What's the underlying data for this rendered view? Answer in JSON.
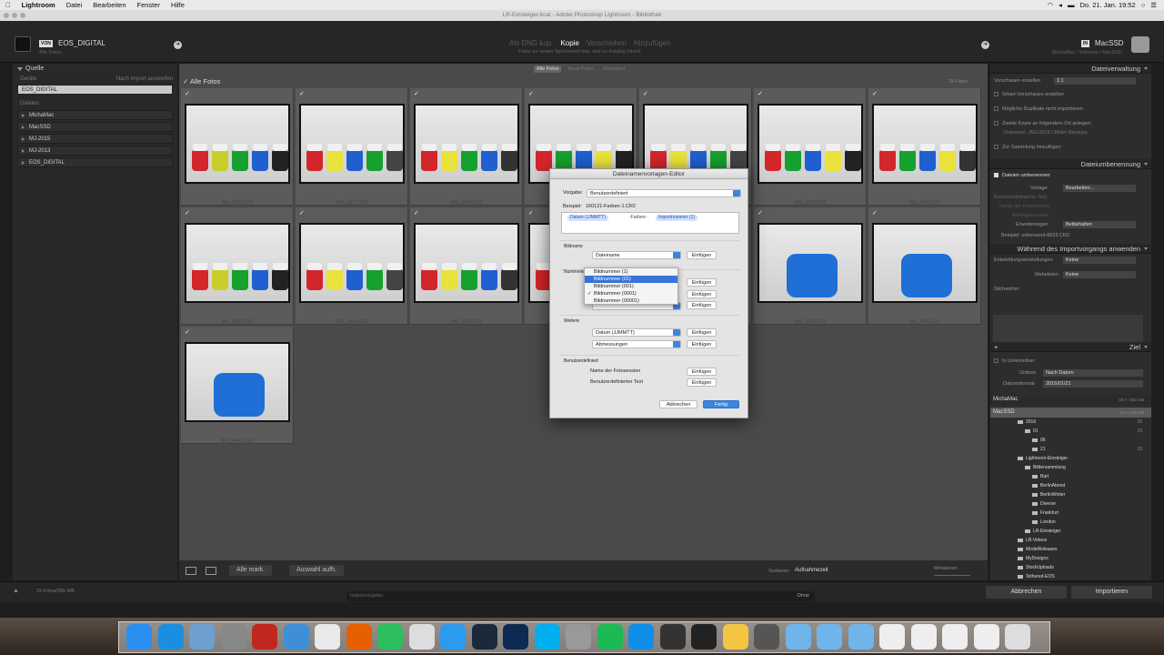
{
  "menubar": {
    "app": "Lightroom",
    "items": [
      "Datei",
      "Bearbeiten",
      "Fenster",
      "Hilfe"
    ],
    "clock": "Do. 21. Jan. 19:52"
  },
  "window": {
    "title": "LR-Einsteiger.lrcat - Adobe Photoshop Lightroom - Bibliothek"
  },
  "header": {
    "source_badge": "VON",
    "source_name": "EOS_DIGITAL",
    "source_sub": "Alle Fotos",
    "modes": [
      "Als DNG kop.",
      "Kopie",
      "Verschieben",
      "Hinzufügen"
    ],
    "active_mode": "Kopie",
    "mode_sub": "Fotos an neuen Speicherort kop. und zu Katalog hinzuf.",
    "dest_badge": "IN",
    "dest_name": "MacSSD",
    "dest_sub": "MichaMac / Volumes / MacSSD"
  },
  "left": {
    "quelle_title": "Quelle",
    "geraete_label": "Geräte",
    "nach_import": "Nach Import auswerfen",
    "device": "EOS_DIGITAL",
    "dateien_label": "Dateien",
    "folders": [
      "MichaMac",
      "MacSSD",
      "MJ-2015",
      "MJ-2013",
      "EOS_DIGITAL"
    ]
  },
  "grid": {
    "tabs": [
      "Alle Fotos",
      "Neue Fotos",
      "Zielordner"
    ],
    "active_tab": "Alle Fotos",
    "header": "Alle Fotos",
    "count": "15 Fotos",
    "checkmark": "✓",
    "files": [
      "IMG_8623.CR2",
      "IMG_8627.CR2",
      "IMG_8628.CR2",
      "IMG_8629.CR2",
      "IMG_8630.CR2",
      "IMG_8631.CR2",
      "IMG_8632.CR2",
      "IMG_8633.CR2",
      "IMG_8634.CR2",
      "IMG_8635.CR2",
      "IMG_8636.CR2",
      "IMG_8637.CR2",
      "IMG_8639.CR2",
      "IMG_8640.CR2",
      "IMG_8641.CR2"
    ]
  },
  "gridbar": {
    "select_all": "Alle mark.",
    "deselect": "Auswahl aufh.",
    "sort_label": "Sortieren:",
    "sort_value": "Aufnahmezeit",
    "mini_label": "Miniaturen"
  },
  "right": {
    "dateiverwaltung": "Dateiverwaltung",
    "vorschauen_label": "Vorschauen erstellen",
    "vorschauen_value": "1:1",
    "smart": "Smart-Vorschauen erstellen",
    "duplikate": "Mögliche Duplikate nicht importieren",
    "zweite_kopie": "Zweite Kopie an folgendem Ort anlegen:",
    "zweite_pfad": "/Volumes/.../MJ-2015 / Bilder Backups",
    "sammlung": "Zur Sammlung hinzufügen",
    "dateiumbenennung": "Dateiumbenennung",
    "dateien_umbenennen": "Dateien umbenennen",
    "vorlage_label": "Vorlage",
    "vorlage_value": "Bearbeiten...",
    "benutzer_text": "Benutzerdefinierter Text",
    "fotosession": "Name der Fotosession",
    "anfangsnummer": "Anfangsnummer",
    "erweiterungen_label": "Erweiterungen",
    "erweiterungen_value": "Beibehalten",
    "beispiel": "Beispiel:  unbenannt-8623.CR2",
    "waehrend": "Während des Importvorgangs anwenden",
    "entwicklung_label": "Entwicklungseinstellungen",
    "entwicklung_value": "Keine",
    "metadaten_label": "Metadaten",
    "metadaten_value": "Keine",
    "stichwoerter": "Stichwörter",
    "ziel": "Ziel",
    "unterordner": "In Unterordner",
    "ordnen_label": "Ordnen",
    "ordnen_value": "Nach Datum",
    "datumsformat_label": "Datumsformat",
    "datumsformat_value": "2016/01/21",
    "disks": [
      {
        "name": "MichaMac",
        "size": "43,7 / 251 GB"
      },
      {
        "name": "MacSSD",
        "size": "123 / 239 GB"
      }
    ],
    "tree": [
      {
        "name": "2016",
        "count": "15"
      },
      {
        "name": "01",
        "count": "15"
      },
      {
        "name": "06",
        "count": ""
      },
      {
        "name": "21",
        "count": "15"
      },
      {
        "name": "Lightroom-Einsteiger",
        "count": ""
      },
      {
        "name": "Bildersammlung",
        "count": ""
      },
      {
        "name": "Bart",
        "count": ""
      },
      {
        "name": "BerlinAbend",
        "count": ""
      },
      {
        "name": "BerlinWinter",
        "count": ""
      },
      {
        "name": "Diverse",
        "count": ""
      },
      {
        "name": "Frankfurt",
        "count": ""
      },
      {
        "name": "London",
        "count": ""
      },
      {
        "name": "LR-Einsteiger",
        "count": ""
      },
      {
        "name": "LR-Videos",
        "count": ""
      },
      {
        "name": "ModelReleases",
        "count": ""
      },
      {
        "name": "MyDesigns",
        "count": ""
      },
      {
        "name": "StockUploads",
        "count": ""
      },
      {
        "name": "Tethered-EOS",
        "count": ""
      }
    ]
  },
  "bottombar": {
    "info": "15 Fotos/356 MB",
    "preset_label": "Importvorgabe:",
    "preset_value": "Ohne",
    "cancel": "Abbrechen",
    "import": "Importieren"
  },
  "dialog": {
    "title": "Dateinamenvorlagen-Editor",
    "vorgabe_label": "Vorgabe:",
    "vorgabe_value": "Benutzerdefiniert",
    "beispiel_label": "Beispiel:",
    "beispiel_value": "160121-Farben-1.CR2",
    "token_datum": "Datum (JJMMTT)",
    "token_text": "-Farben-",
    "token_import": "Importnummer (1)",
    "bildname_section": "Bildname",
    "dateiname_value": "Dateiname",
    "nummerierung_section": "Nummerierung",
    "weitere_section": "Weitere",
    "datum_value": "Datum (JJMMTT)",
    "abmessungen_value": "Abmessungen",
    "benutzerdef_section": "Benutzerdefiniert",
    "fotosession_label": "Name der Fotosession",
    "benutzer_text_label": "Benutzerdefinierter Text",
    "insert": "Einfügen",
    "cancel": "Abbrechen",
    "done": "Fertig",
    "dropdown_options": [
      "Bildnummer (1)",
      "Bildnummer (01)",
      "Bildnummer (001)",
      "Bildnummer (0001)",
      "Bildnummer (00001)"
    ],
    "dropdown_highlight": 1,
    "dropdown_checked": 3,
    "tick": "✓"
  },
  "colors": {
    "accent": "#3874d8",
    "panel": "#2d2d2d",
    "grid": "#4a4a4a"
  }
}
